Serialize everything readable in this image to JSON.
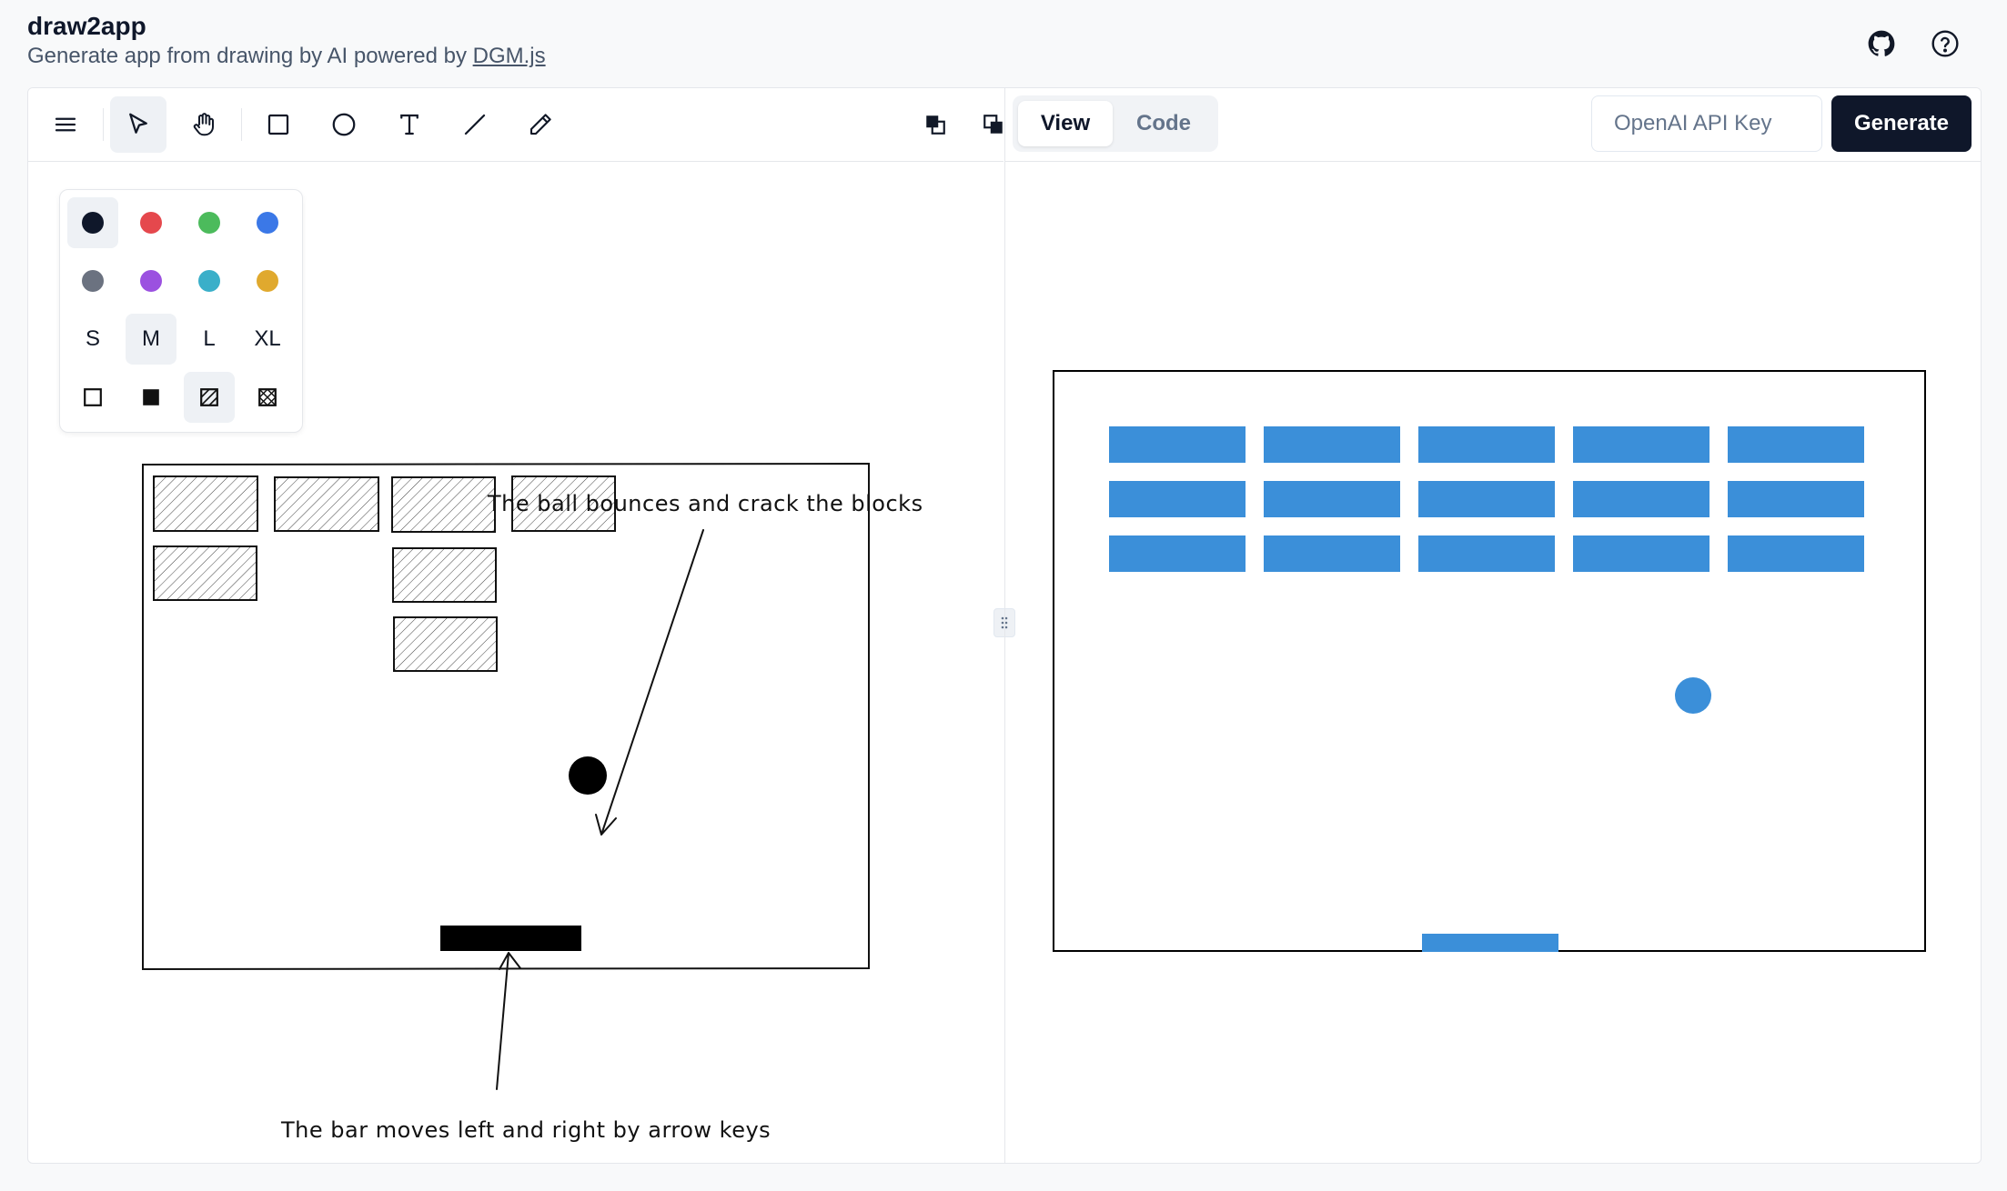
{
  "header": {
    "title": "draw2app",
    "subtitle_prefix": "Generate app from drawing by AI powered by ",
    "subtitle_link": "DGM.js",
    "icons": [
      "github-icon",
      "help-icon"
    ]
  },
  "toolbar": {
    "tools": [
      "menu-icon",
      "select-icon",
      "hand-icon",
      "rectangle-icon",
      "ellipse-icon",
      "text-icon",
      "line-icon",
      "pencil-icon"
    ],
    "active_tool": "select",
    "order_tools": [
      "bring-to-front-icon",
      "send-to-back-icon"
    ]
  },
  "palette": {
    "colors": [
      "#0f172a",
      "#e5484d",
      "#4cbb5c",
      "#3b78e7",
      "#6b7280",
      "#9b51e0",
      "#3aafc9",
      "#e0a92e"
    ],
    "selected_color": "#0f172a",
    "sizes": [
      "S",
      "M",
      "L",
      "XL"
    ],
    "selected_size": "M",
    "fills": [
      "none-fill-icon",
      "solid-fill-icon",
      "hatch-fill-icon",
      "cross-hatch-fill-icon"
    ],
    "selected_fill": "hatch"
  },
  "canvas": {
    "annotation_ball": "The ball bounces and crack the blocks",
    "annotation_bar": "The bar moves left and right by arrow keys"
  },
  "view_tabs": {
    "view_label": "View",
    "code_label": "Code",
    "active": "View"
  },
  "api_key": {
    "placeholder": "OpenAI API Key",
    "value": ""
  },
  "generate_label": "Generate",
  "preview": {
    "brick_color": "#3b8fd9",
    "rows": 3,
    "cols": 5
  }
}
